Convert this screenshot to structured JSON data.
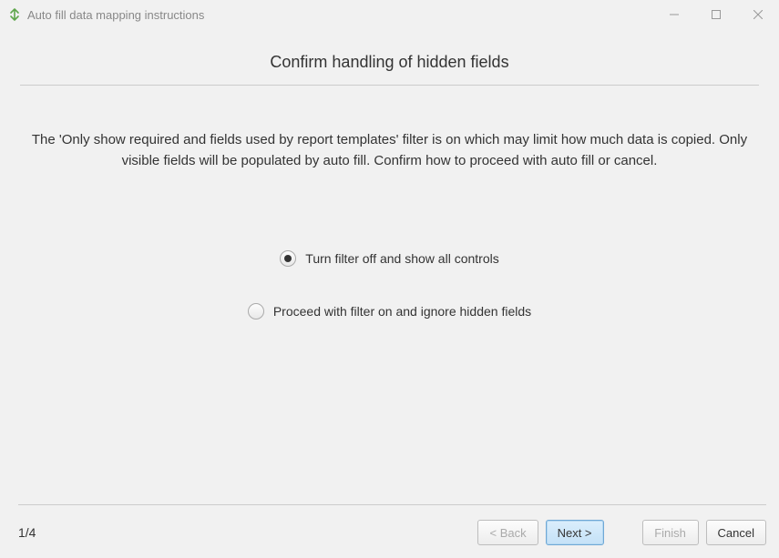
{
  "window": {
    "title": "Auto fill data mapping instructions"
  },
  "page": {
    "title": "Confirm handling of hidden fields",
    "description": "The 'Only show required and fields used by report templates' filter is on which may limit how much data is copied. Only visible fields will be populated by auto fill. Confirm how to proceed with auto fill or cancel."
  },
  "options": {
    "opt1": {
      "label": "Turn filter off and show all controls",
      "selected": true
    },
    "opt2": {
      "label": "Proceed with filter on and ignore hidden fields",
      "selected": false
    }
  },
  "footer": {
    "page_indicator": "1/4",
    "back": "< Back",
    "next": "Next >",
    "finish": "Finish",
    "cancel": "Cancel"
  }
}
